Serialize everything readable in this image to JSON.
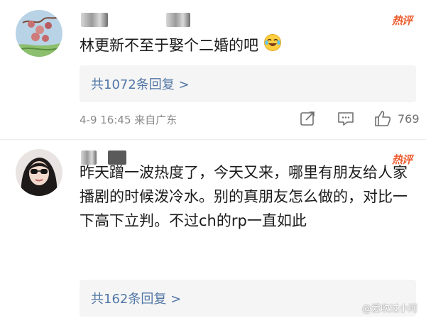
{
  "comments": [
    {
      "badge": "热评",
      "text": "林更新不至于娶个二婚的吧",
      "emoji_icon": "crying-laughing-emoji-icon",
      "replies_label": "共1072条回复 >",
      "date_location": "4-9 16:45 来自广东",
      "like_count": "769"
    },
    {
      "badge": "热评",
      "text": "昨天蹭一波热度了，今天又来，哪里有朋友给人家播剧的时候泼冷水。别的真朋友怎么做的，对比一下高下立判。不过ch的rp一直如此",
      "replies_label": "共162条回复 >"
    }
  ],
  "watermark": "@爱吹过小河",
  "colors": {
    "link": "#5277a6",
    "hot": "#ec5a2c",
    "meta": "#8a8a8a",
    "reply_bg": "#f5f5f5"
  }
}
